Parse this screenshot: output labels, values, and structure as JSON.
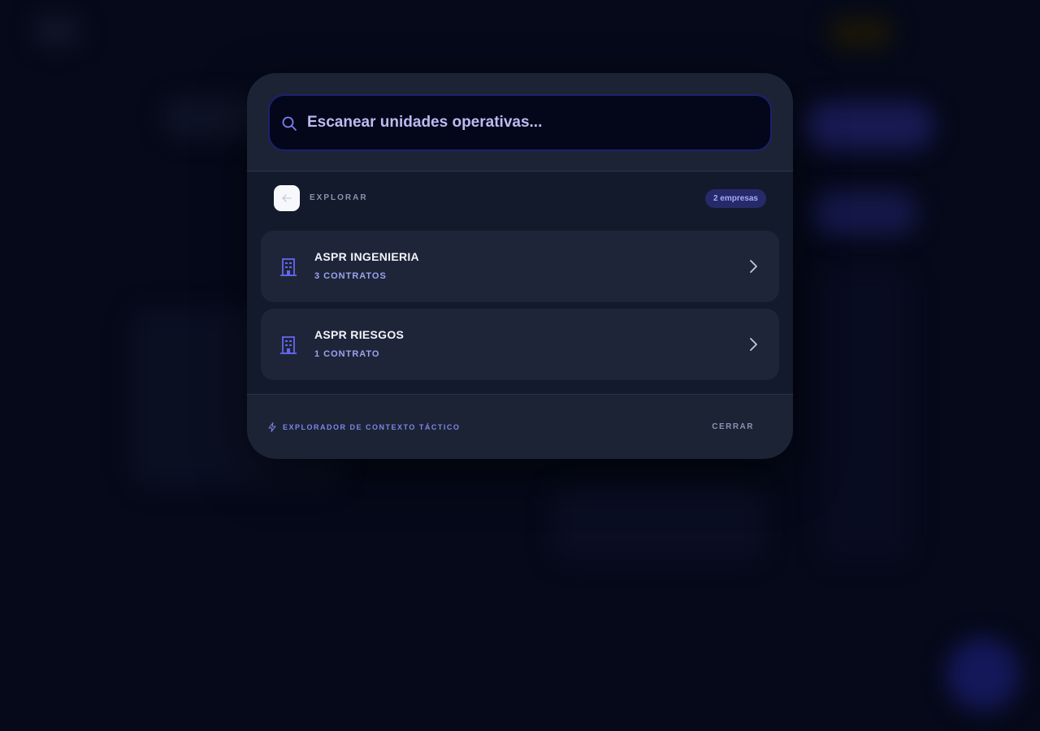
{
  "search": {
    "placeholder": "Escanear unidades operativas...",
    "value": ""
  },
  "navigation": {
    "section_label": "EXPLORAR",
    "count_badge": "2 empresas",
    "back_icon": "arrow-left-icon"
  },
  "companies": [
    {
      "name": "ASPR INGENIERIA",
      "contracts": "3 CONTRATOS",
      "icon": "building-icon"
    },
    {
      "name": "ASPR RIESGOS",
      "contracts": "1 CONTRATO",
      "icon": "building-icon"
    }
  ],
  "footer": {
    "hint": "EXPLORADOR DE CONTEXTO TÁCTICO",
    "hint_icon": "bolt-icon",
    "close_label": "CERRAR"
  },
  "colors": {
    "accent": "#6366f1",
    "modal_bg": "#1c2335",
    "page_bg": "#050919"
  }
}
